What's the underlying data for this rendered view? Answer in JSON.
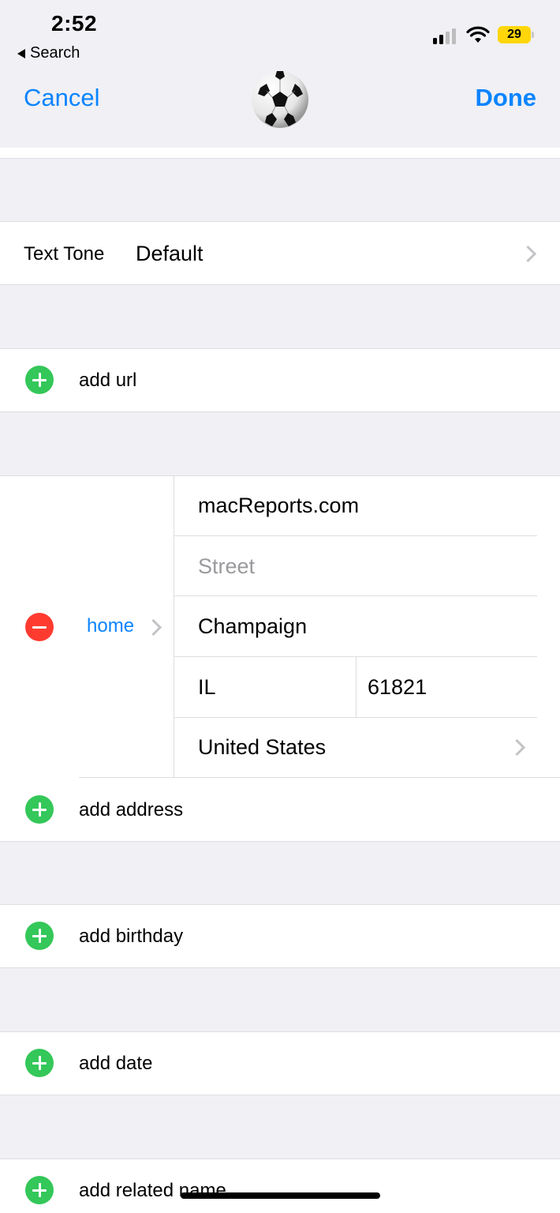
{
  "status_bar": {
    "time": "2:52",
    "back_label": "Search",
    "battery": "29",
    "battery_color": "#ffd60a"
  },
  "nav": {
    "cancel": "Cancel",
    "done": "Done",
    "avatar_icon": "soccer-ball-icon",
    "accent_color": "#0a84ff"
  },
  "text_tone": {
    "label": "Text Tone",
    "value": "Default"
  },
  "add_url": "add url",
  "address": {
    "type_label": "home",
    "line1": "macReports.com",
    "street_placeholder": "Street",
    "city": "Champaign",
    "state": "IL",
    "zip": "61821",
    "country": "United States"
  },
  "add_address": "add address",
  "add_birthday": "add birthday",
  "add_date": "add date",
  "add_related_name": "add related name",
  "colors": {
    "add_green": "#34c759",
    "remove_red": "#ff3b30"
  }
}
